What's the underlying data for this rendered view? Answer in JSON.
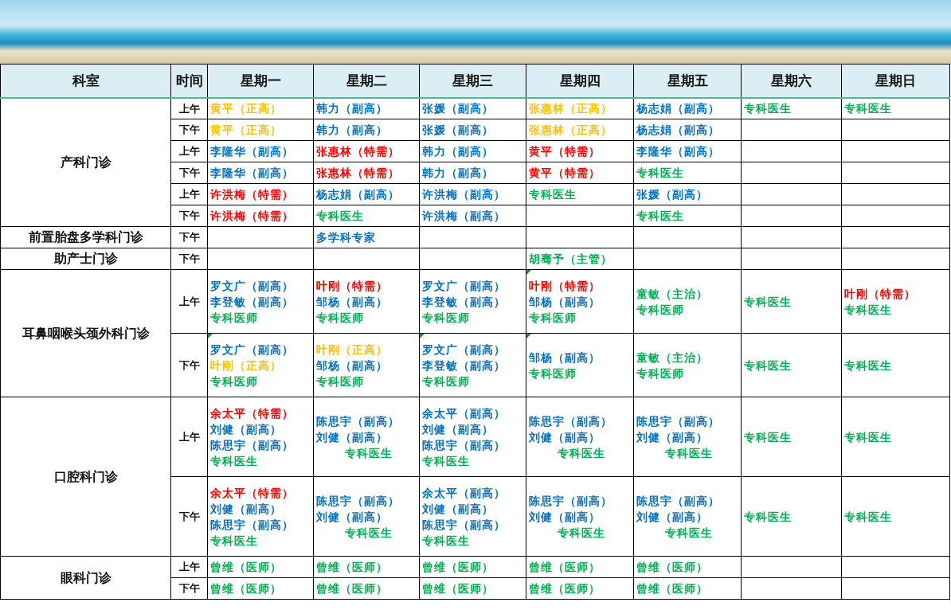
{
  "banner": {
    "kind": "photo"
  },
  "columns": [
    "科室",
    "时间",
    "星期一",
    "星期二",
    "星期三",
    "星期四",
    "星期五",
    "星期六",
    "星期日"
  ],
  "departments": [
    {
      "name": "产科门诊",
      "slots": [
        {
          "time": "上午",
          "cells": [
            {
              "lines": [
                {
                  "text": "黄平（正高）",
                  "color": "#ffc000"
                }
              ]
            },
            {
              "lines": [
                {
                  "text": "韩力（副高）",
                  "color": "#0070c0"
                }
              ]
            },
            {
              "lines": [
                {
                  "text": "张媛（副高）",
                  "color": "#0070c0"
                }
              ]
            },
            {
              "lines": [
                {
                  "text": "张惠林（正高）",
                  "color": "#ffc000"
                }
              ]
            },
            {
              "lines": [
                {
                  "text": "杨志娟（副高）",
                  "color": "#0070c0"
                }
              ]
            },
            {
              "lines": [
                {
                  "text": "专科医生",
                  "color": "#00b050"
                }
              ]
            },
            {
              "lines": [
                {
                  "text": "专科医生",
                  "color": "#00b050"
                }
              ]
            }
          ]
        },
        {
          "time": "下午",
          "cells": [
            {
              "lines": [
                {
                  "text": "黄平（正高）",
                  "color": "#ffc000"
                }
              ]
            },
            {
              "lines": [
                {
                  "text": "韩力（副高）",
                  "color": "#0070c0"
                }
              ]
            },
            {
              "lines": [
                {
                  "text": "张媛（副高）",
                  "color": "#0070c0"
                }
              ]
            },
            {
              "lines": [
                {
                  "text": "张惠林（正高）",
                  "color": "#ffc000"
                }
              ]
            },
            {
              "lines": [
                {
                  "text": "杨志娟（副高）",
                  "color": "#0070c0"
                }
              ]
            },
            {},
            {}
          ]
        },
        {
          "time": "上午",
          "cells": [
            {
              "lines": [
                {
                  "text": "李隆华（副高）",
                  "color": "#0070c0"
                }
              ]
            },
            {
              "lines": [
                {
                  "text": "张惠林（特需）",
                  "color": "#ff0000"
                }
              ]
            },
            {
              "lines": [
                {
                  "text": "韩力（副高）",
                  "color": "#0070c0"
                }
              ]
            },
            {
              "lines": [
                {
                  "text": "黄平（特需）",
                  "color": "#ff0000"
                }
              ]
            },
            {
              "lines": [
                {
                  "text": "李隆华（副高）",
                  "color": "#0070c0"
                }
              ]
            },
            {},
            {}
          ]
        },
        {
          "time": "下午",
          "cells": [
            {
              "lines": [
                {
                  "text": "李隆华（副高）",
                  "color": "#0070c0"
                }
              ]
            },
            {
              "lines": [
                {
                  "text": "张惠林（特需）",
                  "color": "#ff0000"
                }
              ]
            },
            {
              "lines": [
                {
                  "text": "韩力（副高）",
                  "color": "#0070c0"
                }
              ]
            },
            {
              "lines": [
                {
                  "text": "黄平（特需）",
                  "color": "#ff0000"
                }
              ]
            },
            {
              "lines": [
                {
                  "text": "专科医生",
                  "color": "#00b050"
                }
              ]
            },
            {},
            {}
          ]
        },
        {
          "time": "上午",
          "cells": [
            {
              "lines": [
                {
                  "text": "许洪梅（特需）",
                  "color": "#ff0000"
                }
              ]
            },
            {
              "lines": [
                {
                  "text": "杨志娟（副高）",
                  "color": "#0070c0"
                }
              ]
            },
            {
              "lines": [
                {
                  "text": "许洪梅（副高）",
                  "color": "#0070c0"
                }
              ]
            },
            {
              "lines": [
                {
                  "text": "专科医生",
                  "color": "#00b050"
                }
              ]
            },
            {
              "lines": [
                {
                  "text": "张媛（副高）",
                  "color": "#0070c0"
                }
              ]
            },
            {},
            {}
          ]
        },
        {
          "time": "下午",
          "cells": [
            {
              "lines": [
                {
                  "text": "许洪梅（特需）",
                  "color": "#ff0000"
                }
              ]
            },
            {
              "lines": [
                {
                  "text": "专科医生",
                  "color": "#00b050"
                }
              ]
            },
            {
              "lines": [
                {
                  "text": "许洪梅（副高）",
                  "color": "#0070c0"
                }
              ]
            },
            {},
            {
              "lines": [
                {
                  "text": "专科医生",
                  "color": "#00b050"
                }
              ]
            },
            {},
            {}
          ]
        }
      ]
    },
    {
      "name": "前置胎盘多学科门诊",
      "slots": [
        {
          "time": "下午",
          "cells": [
            {},
            {
              "lines": [
                {
                  "text": "多学科专家",
                  "color": "#0070c0"
                }
              ]
            },
            {},
            {},
            {},
            {},
            {}
          ]
        }
      ]
    },
    {
      "name": "助产士门诊",
      "slots": [
        {
          "time": "下午",
          "cells": [
            {},
            {},
            {},
            {
              "lines": [
                {
                  "text": "胡骞予（主管）",
                  "color": "#00b050"
                }
              ]
            },
            {},
            {},
            {}
          ]
        }
      ]
    },
    {
      "name": "耳鼻咽喉头颈外科门诊",
      "slots": [
        {
          "time": "上午",
          "cells": [
            {
              "lines": [
                {
                  "text": "罗文广（副高）",
                  "color": "#0070c0"
                },
                {
                  "text": "李登敏（副高）",
                  "color": "#0070c0"
                },
                {
                  "text": "专科医师",
                  "color": "#00b050"
                }
              ]
            },
            {
              "lines": [
                {
                  "text": "叶刚（特需）",
                  "color": "#ff0000"
                },
                {
                  "text": "邹杨（副高）",
                  "color": "#0070c0"
                },
                {
                  "text": "专科医师",
                  "color": "#00b050"
                }
              ]
            },
            {
              "lines": [
                {
                  "text": "罗文广（副高）",
                  "color": "#0070c0"
                },
                {
                  "text": "李登敏（副高）",
                  "color": "#0070c0"
                },
                {
                  "text": "专科医师",
                  "color": "#00b050"
                }
              ]
            },
            {
              "comment": true,
              "lines": [
                {
                  "text": "叶刚（特需）",
                  "color": "#ff0000"
                },
                {
                  "text": "邹杨（副高）",
                  "color": "#0070c0"
                },
                {
                  "text": "专科医师",
                  "color": "#00b050"
                }
              ]
            },
            {
              "lines": [
                {
                  "text": "童敏（主治）",
                  "color": "#00b050"
                },
                {
                  "text": "专科医师",
                  "color": "#00b050"
                }
              ]
            },
            {
              "lines": [
                {
                  "text": "专科医生",
                  "color": "#00b050"
                }
              ]
            },
            {
              "lines": [
                {
                  "text": "叶刚（特需）",
                  "color": "#ff0000"
                },
                {
                  "text": "专科医生",
                  "color": "#00b050"
                }
              ]
            }
          ]
        },
        {
          "time": "下午",
          "cells": [
            {
              "comment": true,
              "lines": [
                {
                  "text": "罗文广（副高）",
                  "color": "#0070c0"
                },
                {
                  "text": "叶刚（正高）",
                  "color": "#ffc000"
                },
                {
                  "text": "专科医师",
                  "color": "#00b050"
                }
              ]
            },
            {
              "lines": [
                {
                  "text": "叶刚（正高）",
                  "color": "#ffc000"
                },
                {
                  "text": "邹杨（副高）",
                  "color": "#0070c0"
                },
                {
                  "text": "专科医师",
                  "color": "#00b050"
                }
              ]
            },
            {
              "comment": true,
              "lines": [
                {
                  "text": "罗文广（副高）",
                  "color": "#0070c0"
                },
                {
                  "text": "李登敏（副高）",
                  "color": "#0070c0"
                },
                {
                  "text": "专科医师",
                  "color": "#00b050"
                }
              ]
            },
            {
              "comment": true,
              "lines": [
                {
                  "text": "邹杨（副高）",
                  "color": "#0070c0"
                },
                {
                  "text": "专科医师",
                  "color": "#00b050"
                }
              ]
            },
            {
              "lines": [
                {
                  "text": "童敏（主治）",
                  "color": "#00b050"
                },
                {
                  "text": "专科医师",
                  "color": "#00b050"
                }
              ]
            },
            {
              "lines": [
                {
                  "text": "专科医生",
                  "color": "#00b050"
                }
              ]
            },
            {
              "lines": [
                {
                  "text": "专科医生",
                  "color": "#00b050"
                }
              ]
            }
          ]
        }
      ]
    },
    {
      "name": "口腔科门诊",
      "slots": [
        {
          "time": "上午",
          "cells": [
            {
              "lines": [
                {
                  "text": "余太平（特需）",
                  "color": "#ff0000"
                },
                {
                  "text": "刘健（副高）",
                  "color": "#0070c0"
                },
                {
                  "text": "陈思宇（副高）",
                  "color": "#0070c0"
                },
                {
                  "text": "专科医生",
                  "color": "#00b050"
                }
              ]
            },
            {
              "lines": [
                {
                  "text": "陈思宇（副高）",
                  "color": "#0070c0"
                },
                {
                  "text": "刘健（副高）",
                  "color": "#0070c0"
                },
                {
                  "text": "专科医生",
                  "color": "#00b050",
                  "indented": true
                }
              ]
            },
            {
              "lines": [
                {
                  "text": "余太平（副高）",
                  "color": "#0070c0"
                },
                {
                  "text": "刘健（副高）",
                  "color": "#0070c0"
                },
                {
                  "text": "陈思宇（副高）",
                  "color": "#0070c0"
                },
                {
                  "text": "专科医生",
                  "color": "#00b050"
                }
              ]
            },
            {
              "lines": [
                {
                  "text": "陈思宇（副高）",
                  "color": "#0070c0"
                },
                {
                  "text": "刘健（副高）",
                  "color": "#0070c0"
                },
                {
                  "text": "专科医生",
                  "color": "#00b050",
                  "indented": true
                }
              ]
            },
            {
              "lines": [
                {
                  "text": "陈思宇（副高）",
                  "color": "#0070c0"
                },
                {
                  "text": "刘健（副高）",
                  "color": "#0070c0"
                },
                {
                  "text": "专科医生",
                  "color": "#00b050",
                  "indented": true
                }
              ]
            },
            {
              "lines": [
                {
                  "text": "专科医生",
                  "color": "#00b050"
                }
              ]
            },
            {
              "lines": [
                {
                  "text": "专科医生",
                  "color": "#00b050"
                }
              ]
            }
          ]
        },
        {
          "time": "下午",
          "cells": [
            {
              "lines": [
                {
                  "text": "余太平（特需）",
                  "color": "#ff0000"
                },
                {
                  "text": "刘健（副高）",
                  "color": "#0070c0"
                },
                {
                  "text": "陈思宇（副高）",
                  "color": "#0070c0"
                },
                {
                  "text": "专科医生",
                  "color": "#00b050"
                }
              ]
            },
            {
              "lines": [
                {
                  "text": "陈思宇（副高）",
                  "color": "#0070c0"
                },
                {
                  "text": "刘健（副高）",
                  "color": "#0070c0"
                },
                {
                  "text": "专科医生",
                  "color": "#00b050",
                  "indented": true
                }
              ]
            },
            {
              "lines": [
                {
                  "text": "余太平（副高）",
                  "color": "#0070c0"
                },
                {
                  "text": "刘健（副高）",
                  "color": "#0070c0"
                },
                {
                  "text": "陈思宇（副高）",
                  "color": "#0070c0"
                },
                {
                  "text": "专科医生",
                  "color": "#00b050"
                }
              ]
            },
            {
              "lines": [
                {
                  "text": "陈思宇（副高）",
                  "color": "#0070c0"
                },
                {
                  "text": "刘健（副高）",
                  "color": "#0070c0"
                },
                {
                  "text": "专科医生",
                  "color": "#00b050",
                  "indented": true
                }
              ]
            },
            {
              "lines": [
                {
                  "text": "陈思宇（副高）",
                  "color": "#0070c0"
                },
                {
                  "text": "刘健（副高）",
                  "color": "#0070c0"
                },
                {
                  "text": "专科医生",
                  "color": "#00b050",
                  "indented": true
                }
              ]
            },
            {
              "lines": [
                {
                  "text": "专科医生",
                  "color": "#00b050"
                }
              ]
            },
            {
              "lines": [
                {
                  "text": "专科医生",
                  "color": "#00b050"
                }
              ]
            }
          ]
        }
      ]
    },
    {
      "name": "眼科门诊",
      "slots": [
        {
          "time": "上午",
          "cells": [
            {
              "lines": [
                {
                  "text": "曾维（医师）",
                  "color": "#00b050"
                }
              ]
            },
            {
              "lines": [
                {
                  "text": "曾维（医师）",
                  "color": "#00b050"
                }
              ]
            },
            {
              "lines": [
                {
                  "text": "曾维（医师）",
                  "color": "#00b050"
                }
              ]
            },
            {
              "lines": [
                {
                  "text": "曾维（医师）",
                  "color": "#00b050"
                }
              ]
            },
            {
              "lines": [
                {
                  "text": "曾维（医师）",
                  "color": "#00b050"
                }
              ]
            },
            {},
            {}
          ]
        },
        {
          "time": "下午",
          "cells": [
            {
              "lines": [
                {
                  "text": "曾维（医师）",
                  "color": "#00b050"
                }
              ]
            },
            {
              "lines": [
                {
                  "text": "曾维（医师）",
                  "color": "#00b050"
                }
              ]
            },
            {
              "lines": [
                {
                  "text": "曾维（医师）",
                  "color": "#00b050"
                }
              ]
            },
            {
              "lines": [
                {
                  "text": "曾维（医师）",
                  "color": "#00b050"
                }
              ]
            },
            {
              "lines": [
                {
                  "text": "曾维（医师）",
                  "color": "#00b050"
                }
              ]
            },
            {},
            {}
          ]
        }
      ]
    }
  ]
}
